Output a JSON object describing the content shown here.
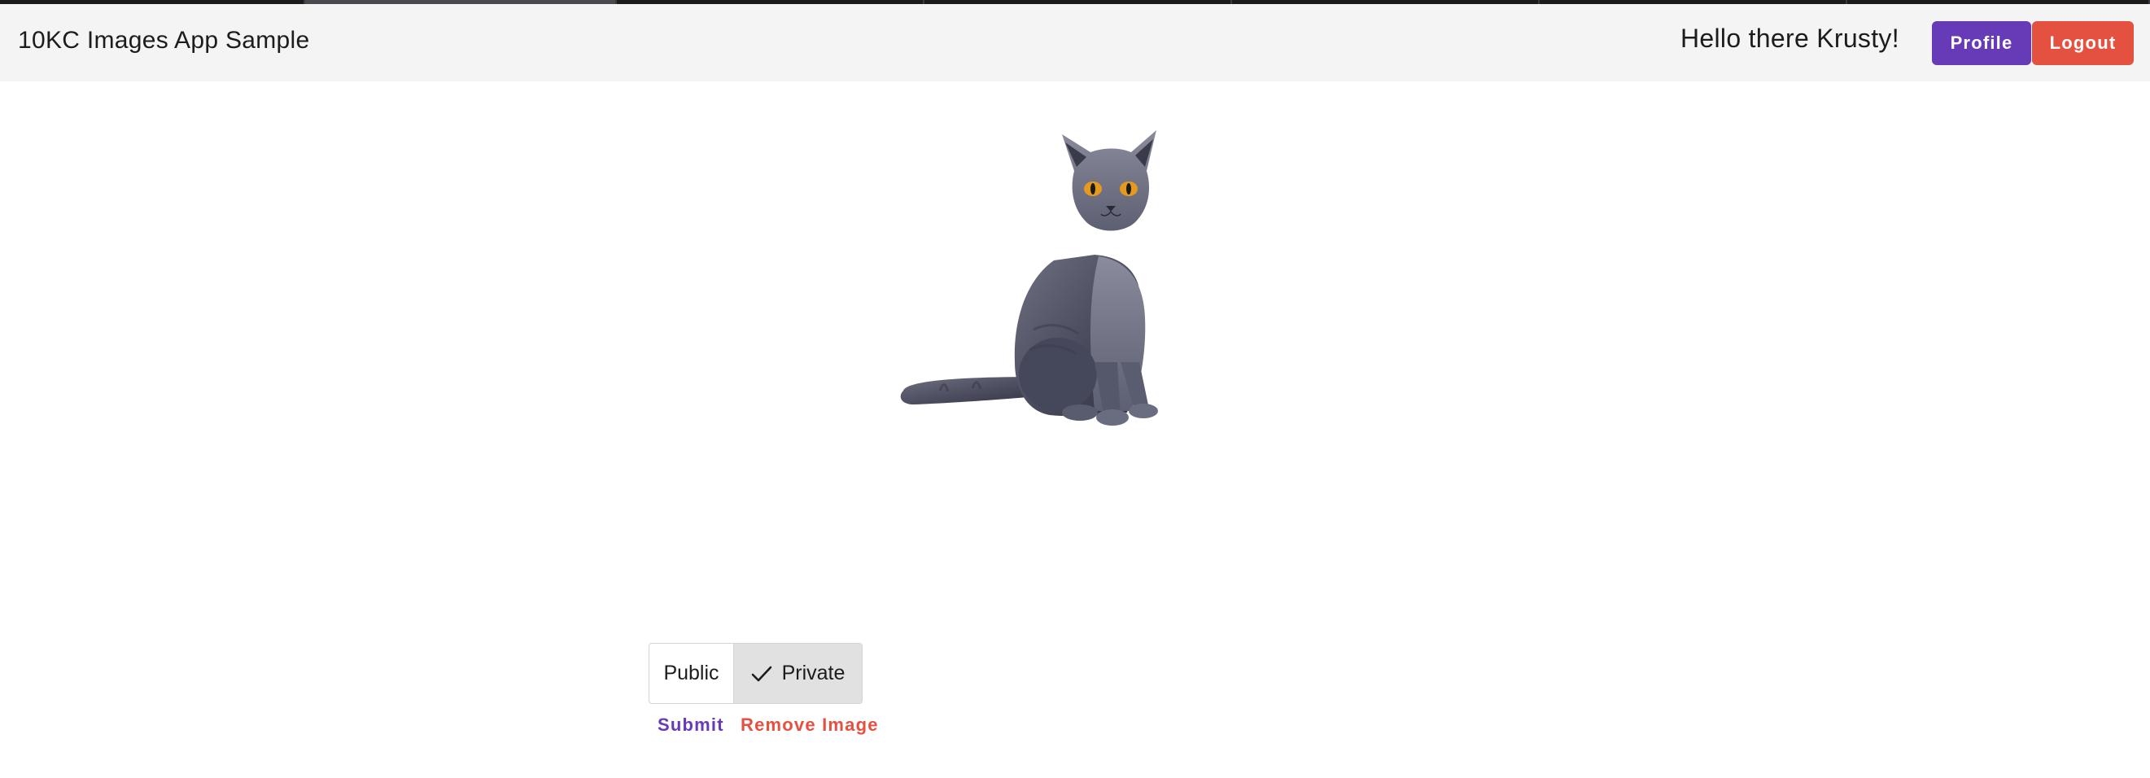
{
  "header": {
    "app_title": "10KC Images App Sample",
    "greeting": "Hello there Krusty!",
    "profile_label": "Profile",
    "logout_label": "Logout"
  },
  "colors": {
    "primary": "#673ab7",
    "danger": "#e45141",
    "header_bg": "#f4f4f4"
  },
  "image": {
    "subject": "cat-image"
  },
  "visibility_toggle": {
    "options": [
      {
        "label": "Public",
        "selected": false
      },
      {
        "label": "Private",
        "selected": true
      }
    ]
  },
  "actions": {
    "submit_label": "Submit",
    "remove_label": "Remove Image"
  }
}
